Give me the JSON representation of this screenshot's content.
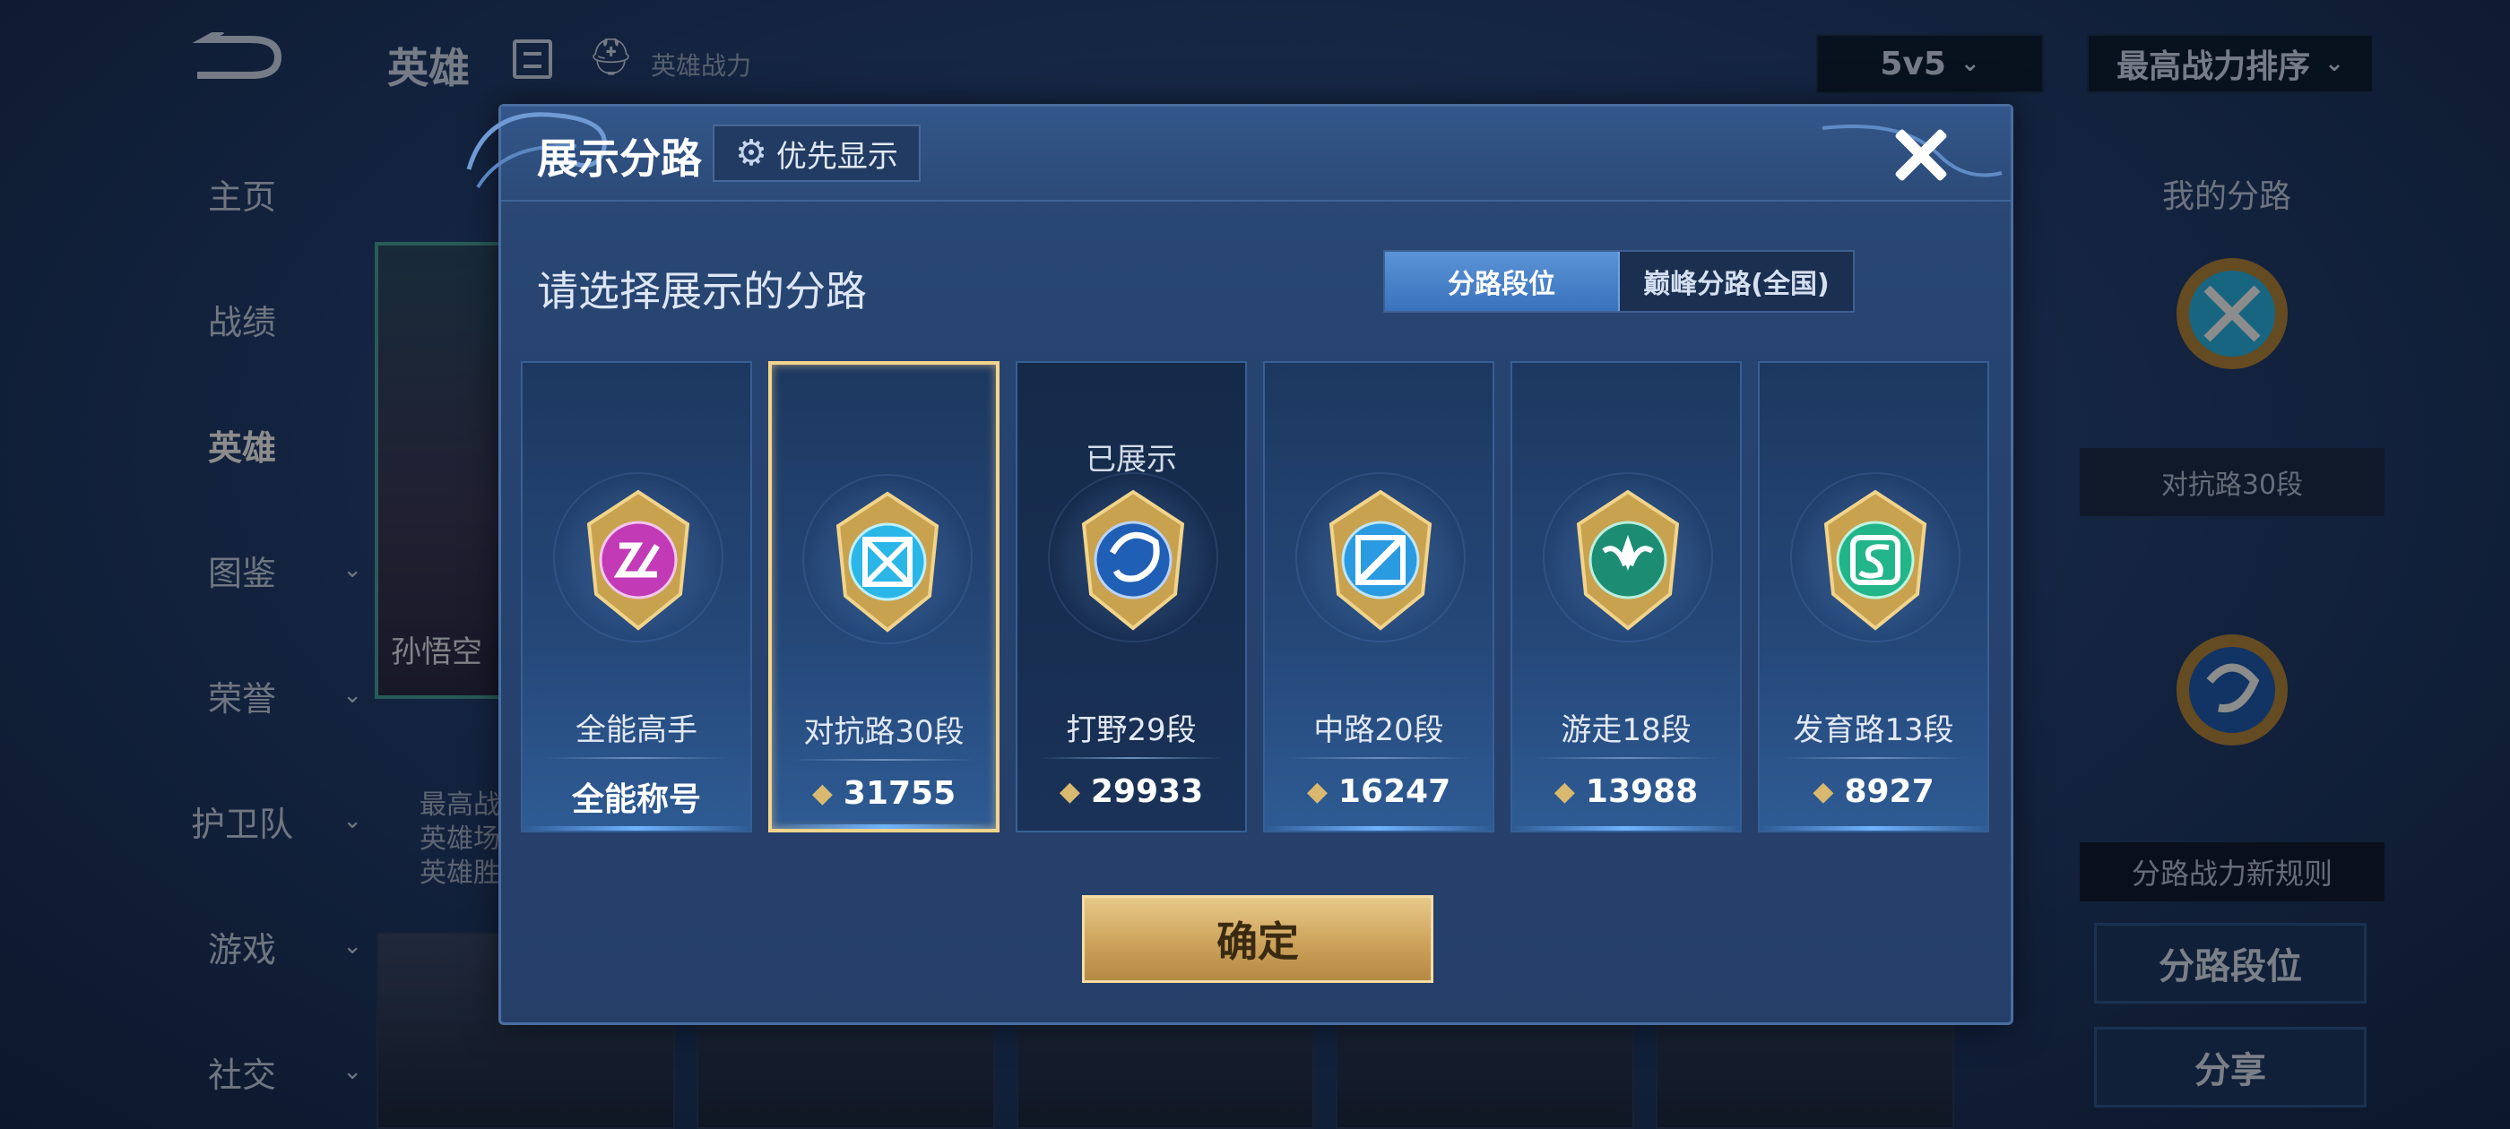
{
  "app": {
    "title": "英雄",
    "power_label": "英雄战力",
    "mode_dropdown": "5v5",
    "sort_dropdown": "最高战力排序"
  },
  "side_nav": [
    {
      "label": "主页",
      "expandable": false
    },
    {
      "label": "战绩",
      "expandable": false
    },
    {
      "label": "英雄",
      "expandable": false,
      "active": true
    },
    {
      "label": "图鉴",
      "expandable": true
    },
    {
      "label": "荣誉",
      "expandable": true
    },
    {
      "label": "护卫队",
      "expandable": true
    },
    {
      "label": "游戏",
      "expandable": true
    },
    {
      "label": "社交",
      "expandable": true
    }
  ],
  "hero": {
    "name": "孙悟空",
    "stats": [
      "最高战",
      "英雄场",
      "英雄胜"
    ]
  },
  "right_panel": {
    "title": "我的分路",
    "rank": "对抗路30段",
    "rules": "分路战力新规则",
    "seg_button": "分路段位",
    "share_button": "分享"
  },
  "modal": {
    "title": "展示分路",
    "priority_button": "优先显示",
    "subtitle": "请选择展示的分路",
    "tabs": [
      "分路段位",
      "巅峰分路(全国)"
    ],
    "active_tab": 0,
    "shown_label": "已展示",
    "confirm_button": "确定",
    "cards": [
      {
        "name": "全能高手",
        "value": "全能称号",
        "emblem": "all-round-icon",
        "color": "#c23ab6",
        "selected": false,
        "shown": false,
        "has_power_icon": false
      },
      {
        "name": "对抗路30段",
        "value": "31755",
        "emblem": "clash-lane-icon",
        "color": "#2ab7e8",
        "selected": true,
        "shown": false,
        "has_power_icon": true
      },
      {
        "name": "打野29段",
        "value": "29933",
        "emblem": "jungle-icon",
        "color": "#1f5fb5",
        "selected": false,
        "shown": true,
        "has_power_icon": true
      },
      {
        "name": "中路20段",
        "value": "16247",
        "emblem": "mid-lane-icon",
        "color": "#2a9be0",
        "selected": false,
        "shown": false,
        "has_power_icon": true
      },
      {
        "name": "游走18段",
        "value": "13988",
        "emblem": "roam-icon",
        "color": "#1c8d73",
        "selected": false,
        "shown": false,
        "has_power_icon": true
      },
      {
        "name": "发育路13段",
        "value": "8927",
        "emblem": "farm-lane-icon",
        "color": "#22b58a",
        "selected": false,
        "shown": false,
        "has_power_icon": true
      }
    ]
  }
}
